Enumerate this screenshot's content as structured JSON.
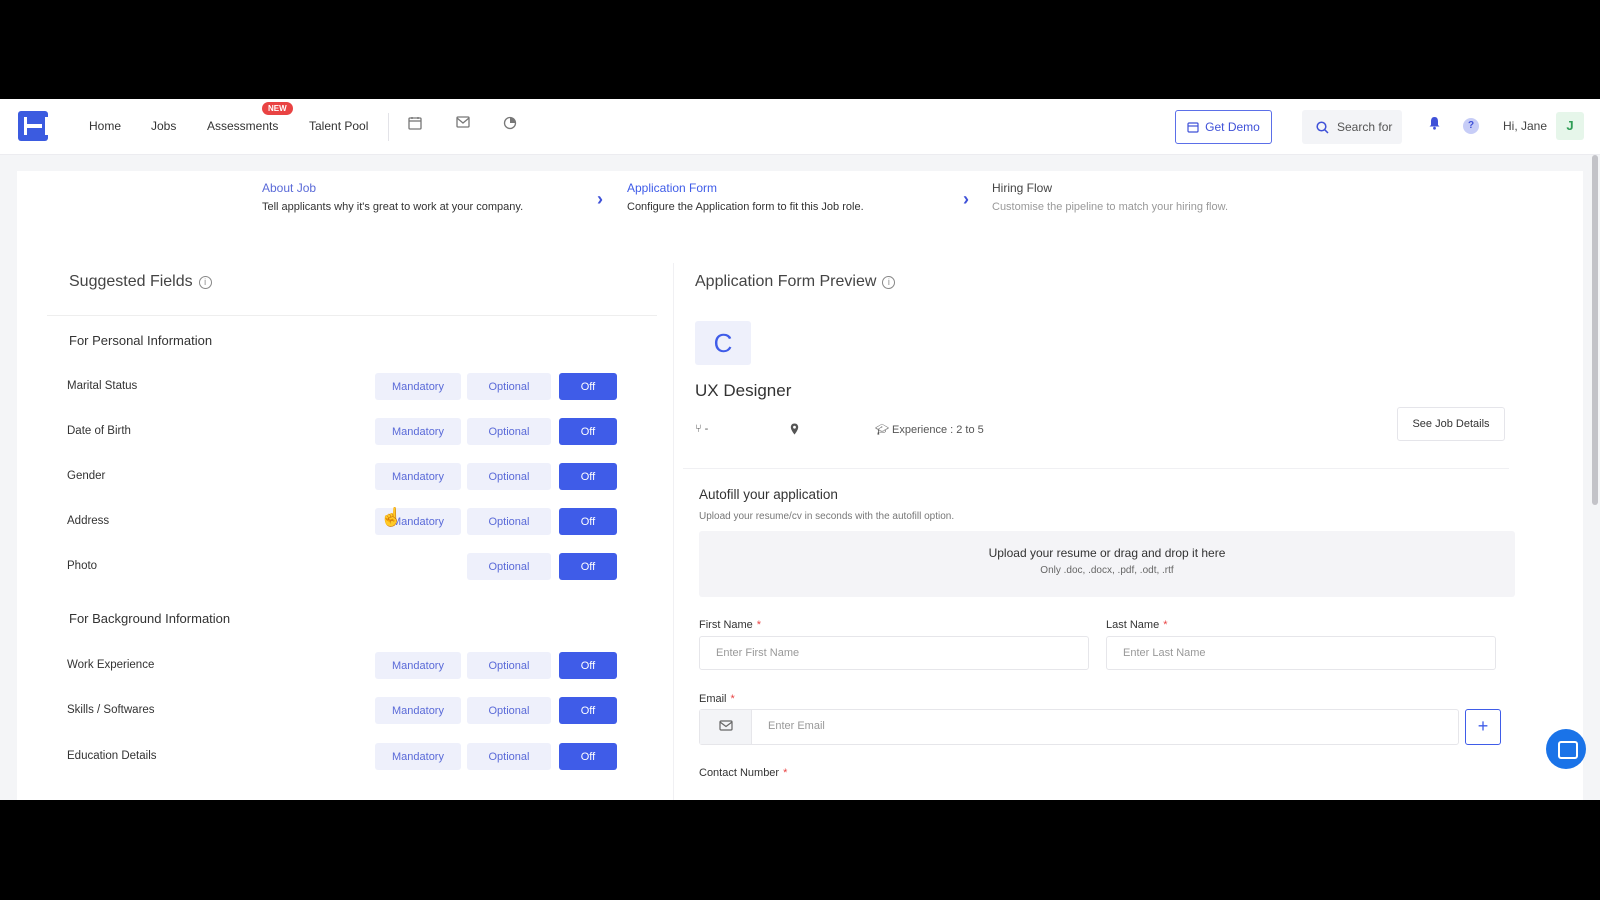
{
  "nav": {
    "items": [
      "Home",
      "Jobs",
      "Assessments",
      "Talent Pool"
    ],
    "new_badge": "NEW",
    "get_demo": "Get Demo",
    "search": "Search for",
    "greeting": "Hi, Jane",
    "avatar_initial": "J"
  },
  "stepper": {
    "steps": [
      {
        "title": "About Job",
        "desc": "Tell applicants why it's great to work at your company."
      },
      {
        "title": "Application Form",
        "desc": "Configure the Application form to fit this Job role."
      },
      {
        "title": "Hiring Flow",
        "desc": "Customise the pipeline to match your hiring flow."
      }
    ]
  },
  "suggested": {
    "title": "Suggested Fields",
    "personal_title": "For Personal Information",
    "personal_fields": [
      "Marital Status",
      "Date of Birth",
      "Gender",
      "Address",
      "Photo"
    ],
    "background_title": "For Background Information",
    "background_fields": [
      "Work Experience",
      "Skills / Softwares",
      "Education Details"
    ],
    "btn_mandatory": "Mandatory",
    "btn_optional": "Optional",
    "btn_off": "Off"
  },
  "preview": {
    "title": "Application Form Preview",
    "company_initial": "C",
    "job_title": "UX Designer",
    "meta_dept": "-",
    "meta_experience": "Experience : 2 to 5",
    "see_job_details": "See Job Details",
    "autofill_title": "Autofill your application",
    "autofill_sub": "Upload your resume/cv in seconds with the autofill option.",
    "dropzone_title": "Upload your resume or drag and drop it here",
    "dropzone_sub": "Only .doc, .docx, .pdf, .odt, .rtf",
    "first_name_label": "First Name",
    "first_name_placeholder": "Enter First Name",
    "last_name_label": "Last Name",
    "last_name_placeholder": "Enter Last Name",
    "email_label": "Email",
    "email_placeholder": "Enter Email",
    "contact_label": "Contact Number",
    "required_mark": "*"
  },
  "colors": {
    "accent": "#3f5ce8",
    "badge": "#e94343"
  }
}
